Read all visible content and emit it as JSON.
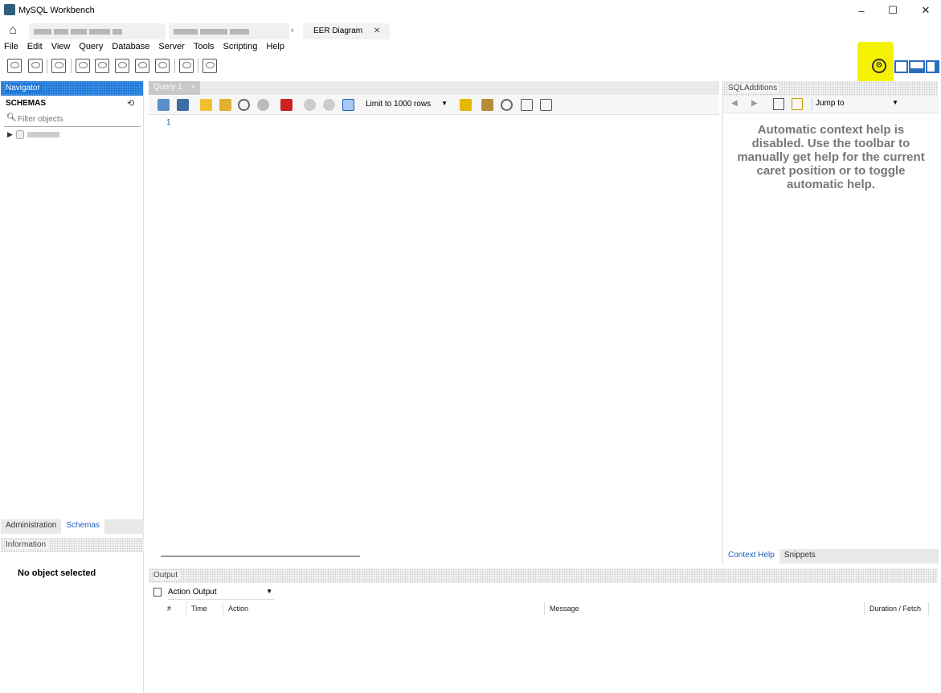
{
  "window": {
    "title": "MySQL Workbench",
    "minimize": "–",
    "maximize": "☐",
    "close": "✕"
  },
  "tabs": {
    "home_icon": "home-icon",
    "scroll_left": "‹",
    "eer_tab": "EER Diagram",
    "eer_close": "✕"
  },
  "menu": [
    "File",
    "Edit",
    "View",
    "Query",
    "Database",
    "Server",
    "Tools",
    "Scripting",
    "Help"
  ],
  "navigator": {
    "header": "Navigator",
    "schemas_label": "SCHEMAS",
    "filter_placeholder": "Filter objects",
    "bottom_tabs": [
      "Administration",
      "Schemas"
    ],
    "info_header": "Information",
    "no_object": "No object selected"
  },
  "editor": {
    "tab_label": "Query 1",
    "tab_close": "×",
    "limit_label": "Limit to 1000 rows",
    "line_number": "1"
  },
  "sql_additions": {
    "header": "SQLAdditions",
    "jump_to": "Jump to",
    "help_text": "Automatic context help is disabled. Use the toolbar to manually get help for the current caret position or to toggle automatic help.",
    "tabs": [
      "Context Help",
      "Snippets"
    ]
  },
  "output": {
    "header": "Output",
    "selector": "Action Output",
    "columns": [
      "#",
      "Time",
      "Action",
      "Message",
      "Duration / Fetch"
    ]
  },
  "colors": {
    "accent": "#1e78d8",
    "highlight": "#f6f100"
  }
}
